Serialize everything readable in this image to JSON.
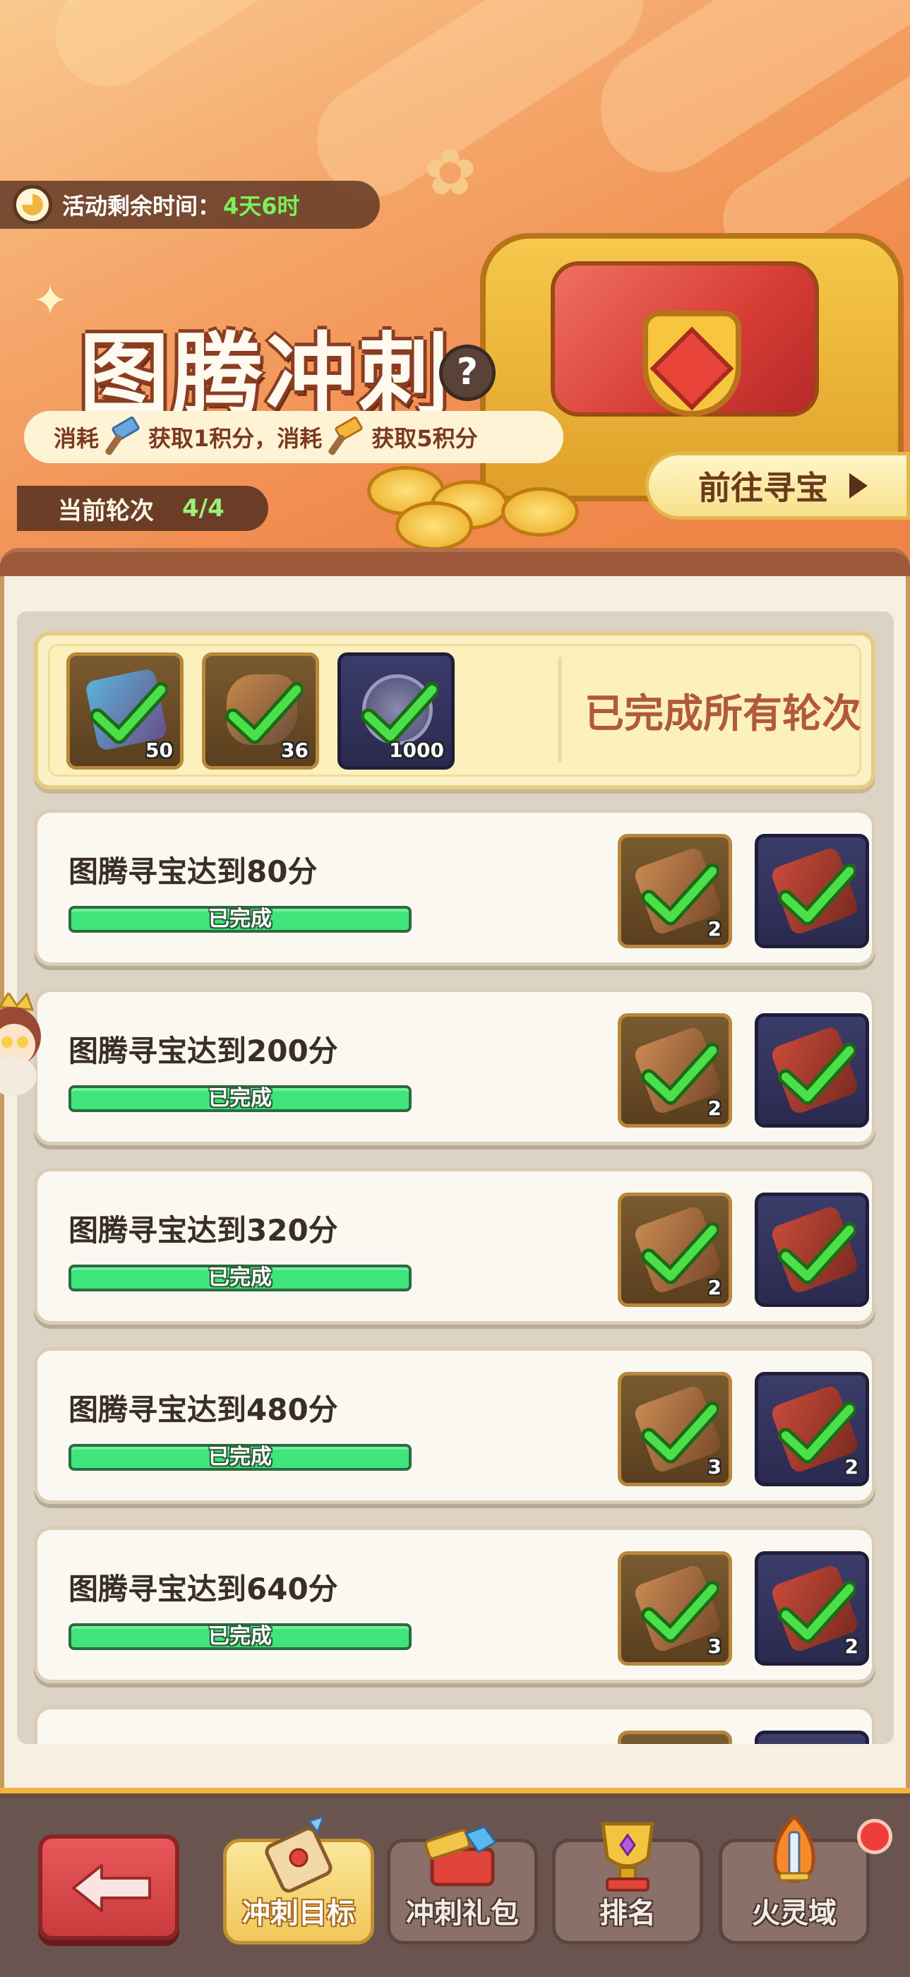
{
  "header": {
    "timer_label": "活动剩余时间：",
    "timer_value": "4天6时",
    "title": "图腾冲刺",
    "help_label": "?",
    "rule_part1": "消耗",
    "rule_part2": "获取1积分，消耗",
    "rule_part3": "获取5积分",
    "round_label": "当前轮次",
    "round_value": "4/4",
    "go_button_label": "前往寻宝"
  },
  "summary": {
    "rewards": [
      {
        "icon": "blue-ticket-icon",
        "count": "50",
        "tile": "brown"
      },
      {
        "icon": "stone-shard-icon",
        "count": "36",
        "tile": "brown"
      },
      {
        "icon": "silver-coin-icon",
        "count": "1000",
        "tile": "navy"
      }
    ],
    "status": "已完成所有轮次"
  },
  "tasks": [
    {
      "title": "图腾寻宝达到80分",
      "status": "已完成",
      "progress": 1.0,
      "reward1_count": "2",
      "reward2_count": ""
    },
    {
      "title": "图腾寻宝达到200分",
      "status": "已完成",
      "progress": 1.0,
      "reward1_count": "2",
      "reward2_count": ""
    },
    {
      "title": "图腾寻宝达到320分",
      "status": "已完成",
      "progress": 1.0,
      "reward1_count": "2",
      "reward2_count": ""
    },
    {
      "title": "图腾寻宝达到480分",
      "status": "已完成",
      "progress": 1.0,
      "reward1_count": "3",
      "reward2_count": "2"
    },
    {
      "title": "图腾寻宝达到640分",
      "status": "已完成",
      "progress": 1.0,
      "reward1_count": "3",
      "reward2_count": "2"
    }
  ],
  "nav": {
    "tabs": [
      {
        "label": "冲刺目标",
        "icon": "scroll-icon",
        "active": true
      },
      {
        "label": "冲刺礼包",
        "icon": "gift-chest-icon",
        "active": false
      },
      {
        "label": "排名",
        "icon": "trophy-icon",
        "active": false
      },
      {
        "label": "火灵域",
        "icon": "flame-sword-icon",
        "active": false
      }
    ]
  },
  "colors": {
    "accent": "#f3b23a",
    "progress_fill": "#3fe47a",
    "timer_value": "#7cf05a",
    "done_text": "#b05a3a"
  }
}
